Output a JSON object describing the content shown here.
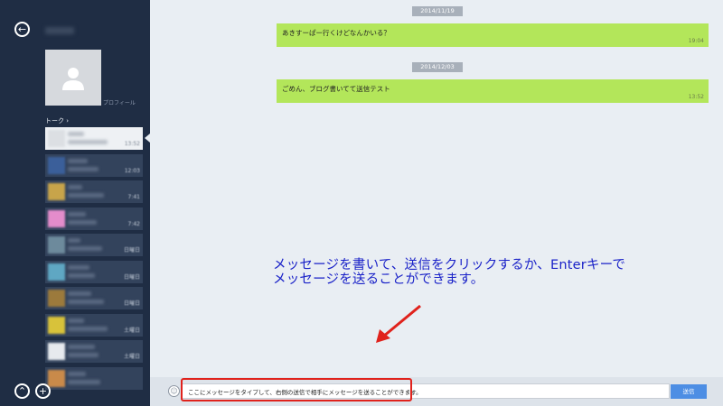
{
  "sidebar": {
    "profile_label": "プロフィール",
    "talk_label": "トーク",
    "chats": [
      {
        "time": "13:52",
        "active": true,
        "thumb": "#dcdfe3"
      },
      {
        "time": "12:03",
        "active": false,
        "thumb": "#3b5f9a"
      },
      {
        "time": "7:41",
        "active": false,
        "thumb": "#c8a44a"
      },
      {
        "time": "7:42",
        "active": false,
        "thumb": "#e48ccb"
      },
      {
        "time": "日曜日",
        "active": false,
        "thumb": "#6d8a9c"
      },
      {
        "time": "日曜日",
        "active": false,
        "thumb": "#5fa7c3"
      },
      {
        "time": "日曜日",
        "active": false,
        "thumb": "#9c7a3c"
      },
      {
        "time": "土曜日",
        "active": false,
        "thumb": "#d8c23a"
      },
      {
        "time": "土曜日",
        "active": false,
        "thumb": "#e7eaee"
      },
      {
        "time": "",
        "active": false,
        "thumb": "#c98a4a"
      }
    ]
  },
  "conversation": [
    {
      "date": "2014/11/19",
      "message": "あきすーぱー行くけどなんかいる？",
      "time": "19:04"
    },
    {
      "date": "2014/12/03",
      "message": "ごめん、ブログ書いてて送信テスト",
      "time": "13:52"
    }
  ],
  "annotation": {
    "line1": "メッセージを書いて、送信をクリックするか、Enterキーで",
    "line2": "メッセージを送ることができます。"
  },
  "input": {
    "value": "ここにメッセージをタイプして、右側の送信で相手にメッセージを送ることができます。",
    "send_label": "送信"
  },
  "colors": {
    "sidebar_bg": "#1f2d44",
    "bubble": "#b3e65a",
    "annotation": "#1a22c8",
    "highlight": "#e0221c",
    "send_button": "#4d8ee4"
  }
}
